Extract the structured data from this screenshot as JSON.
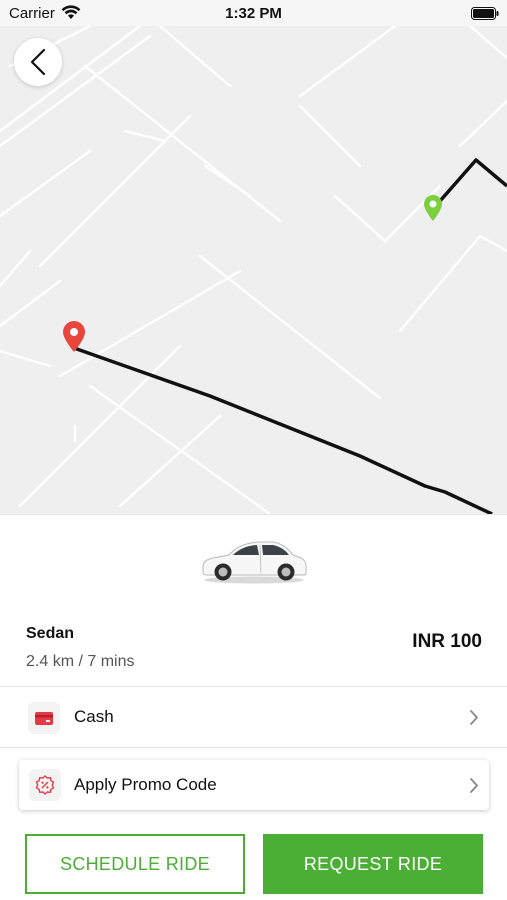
{
  "status_bar": {
    "carrier": "Carrier",
    "time": "1:32 PM"
  },
  "map": {
    "pickup_marker": "green-pin-icon",
    "dropoff_marker": "red-pin-icon",
    "route_color": "#111111",
    "pickup_color": "#7ccf3f",
    "dropoff_color": "#e8453c"
  },
  "ride": {
    "vehicle_image": "white-sedan-car",
    "vehicle_name": "Sedan",
    "trip_info": "2.4 km / 7 mins",
    "fare": "INR 100"
  },
  "payment": {
    "icon": "card-icon",
    "label": "Cash"
  },
  "promo": {
    "icon": "promo-badge-icon",
    "label": "Apply Promo Code"
  },
  "actions": {
    "schedule_label": "SCHEDULE RIDE",
    "request_label": "REQUEST RIDE"
  },
  "colors": {
    "accent": "#4caf35",
    "map_bg": "#efefef",
    "map_road": "#ffffff"
  }
}
